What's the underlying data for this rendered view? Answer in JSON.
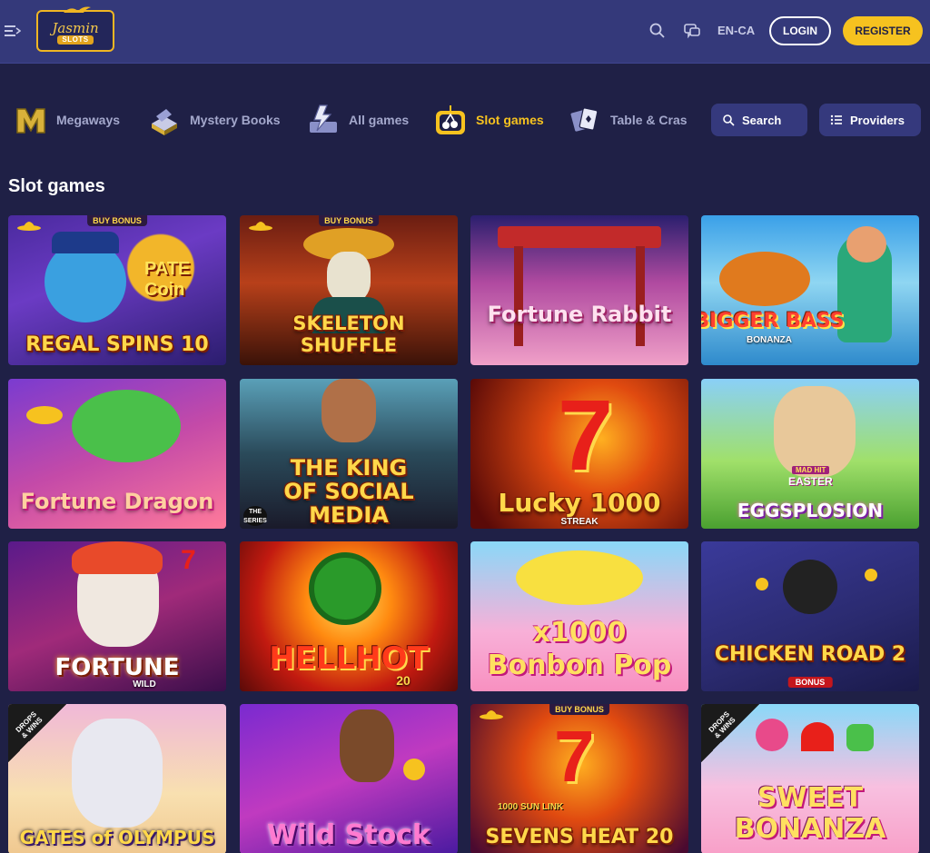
{
  "header": {
    "logo_name": "Jasmin",
    "logo_sub": "SLOTS",
    "language": "EN-CA",
    "login_label": "LOGIN",
    "register_label": "REGISTER"
  },
  "categories": [
    {
      "label": "Megaways",
      "icon": "megaways-icon",
      "active": false
    },
    {
      "label": "Mystery Books",
      "icon": "book-icon",
      "active": false
    },
    {
      "label": "All games",
      "icon": "all-games-icon",
      "active": false
    },
    {
      "label": "Slot games",
      "icon": "cherry-icon",
      "active": true
    },
    {
      "label": "Table & Cras",
      "icon": "cards-icon",
      "active": false
    }
  ],
  "search_label": "Search",
  "providers_label": "Providers",
  "section_title": "Slot games",
  "games": [
    {
      "title": "REGAL SPINS 10",
      "extra": "PATE Coin",
      "badge": "BUY BONUS",
      "hat": true
    },
    {
      "title": "SKELETON SHUFFLE",
      "badge": "BUY BONUS",
      "hat": true
    },
    {
      "title": "Fortune Rabbit"
    },
    {
      "title": "BIGGER BASS",
      "sub": "BONANZA"
    },
    {
      "title": "Fortune Dragon"
    },
    {
      "title": "THE KING OF SOCIAL MEDIA",
      "extra": "THE SERIES"
    },
    {
      "title": "Lucky 1000",
      "sub": "STREAK"
    },
    {
      "title": "EGGSPLOSION",
      "extra": "EASTER",
      "tag": "MAD HIT"
    },
    {
      "title": "FORTUNE",
      "sub": "WILD"
    },
    {
      "title": "HELLHOT",
      "sub": "20"
    },
    {
      "title": "x1000 Bonbon Pop"
    },
    {
      "title": "CHICKEN ROAD 2",
      "tag": "BONUS"
    },
    {
      "title": "GATES of OLYMPUS",
      "drops": "DROPS & WINS"
    },
    {
      "title": "Wild Stock"
    },
    {
      "title": "SEVENS HEAT 20",
      "badge": "BUY BONUS",
      "hat": true,
      "extra": "1000 SUN LINK"
    },
    {
      "title": "SWEET BONANZA",
      "drops": "DROPS & WINS"
    }
  ],
  "colors": {
    "header_bg": "#34397a",
    "page_bg": "#1f2046",
    "accent": "#f6c21f"
  }
}
